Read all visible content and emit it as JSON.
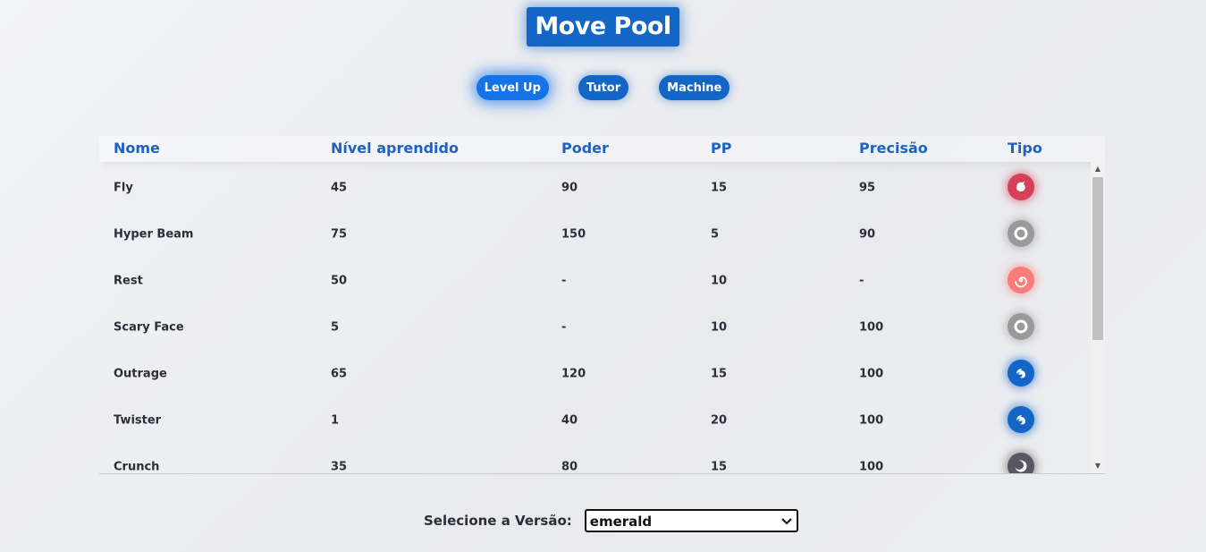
{
  "header": {
    "title": "Move Pool"
  },
  "tabs": [
    {
      "label": "Level Up",
      "active": true
    },
    {
      "label": "Tutor",
      "active": false
    },
    {
      "label": "Machine",
      "active": false
    }
  ],
  "table": {
    "columns": [
      "Nome",
      "Nível aprendido",
      "Poder",
      "PP",
      "Precisão",
      "Tipo"
    ],
    "rows": [
      {
        "name": "Fly",
        "level": "45",
        "power": "90",
        "pp": "15",
        "accuracy": "95",
        "type_icon": "flying-icon",
        "type_color": "#d5415a"
      },
      {
        "name": "Hyper Beam",
        "level": "75",
        "power": "150",
        "pp": "5",
        "accuracy": "90",
        "type_icon": "normal-icon",
        "type_color": "#9a9a9a"
      },
      {
        "name": "Rest",
        "level": "50",
        "power": "-",
        "pp": "10",
        "accuracy": "-",
        "type_icon": "psychic-icon",
        "type_color": "#f87c78"
      },
      {
        "name": "Scary Face",
        "level": "5",
        "power": "-",
        "pp": "10",
        "accuracy": "100",
        "type_icon": "normal-icon",
        "type_color": "#9a9a9a"
      },
      {
        "name": "Outrage",
        "level": "65",
        "power": "120",
        "pp": "15",
        "accuracy": "100",
        "type_icon": "dragon-icon",
        "type_color": "#1366c6"
      },
      {
        "name": "Twister",
        "level": "1",
        "power": "40",
        "pp": "20",
        "accuracy": "100",
        "type_icon": "dragon-icon",
        "type_color": "#1366c6"
      },
      {
        "name": "Crunch",
        "level": "35",
        "power": "80",
        "pp": "15",
        "accuracy": "100",
        "type_icon": "dark-icon",
        "type_color": "#595761"
      }
    ]
  },
  "version": {
    "label": "Selecione a Versão:",
    "selected": "emerald"
  }
}
